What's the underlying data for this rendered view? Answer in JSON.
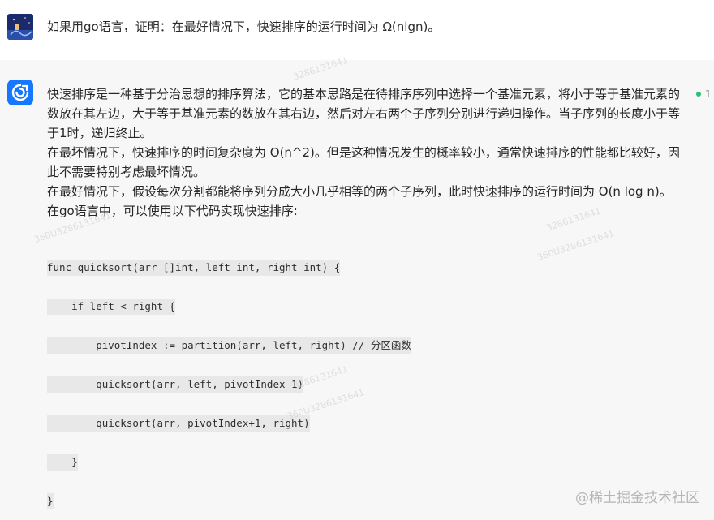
{
  "user": {
    "question": "如果用go语言，证明：在最好情况下，快速排序的运行时间为 Ω(nlgn)。"
  },
  "assistant": {
    "paragraphs": [
      "快速排序是一种基于分治思想的排序算法，它的基本思路是在待排序序列中选择一个基准元素，将小于等于基准元素的数放在其左边，大于等于基准元素的数放在其右边，然后对左右两个子序列分别进行递归操作。当子序列的长度小于等于1时，递归终止。",
      "在最坏情况下，快速排序的时间复杂度为 O(n^2)。但是这种情况发生的概率较小，通常快速排序的性能都比较好，因此不需要特别考虑最坏情况。",
      "在最好情况下，假设每次分割都能将序列分成大小几乎相等的两个子序列，此时快速排序的运行时间为 O(n log n)。",
      "在go语言中，可以使用以下代码实现快速排序:"
    ],
    "status_label": "1",
    "code_lines": [
      "func quicksort(arr []int, left int, right int) {",
      "    if left < right {",
      "        pivotIndex := partition(arr, left, right) // 分区函数",
      "        quicksort(arr, left, pivotIndex-1)",
      "        quicksort(arr, pivotIndex+1, right)",
      "    }",
      "}"
    ]
  },
  "watermarks": [
    "3286131641",
    "360U3286131641"
  ],
  "footer_watermark": "@稀土掘金技术社区",
  "colors": {
    "bot_background": "#f7f7f8",
    "avatar_blue": "#1677ff",
    "status_green": "#2fbf71",
    "code_background": "#e8e8e8"
  }
}
